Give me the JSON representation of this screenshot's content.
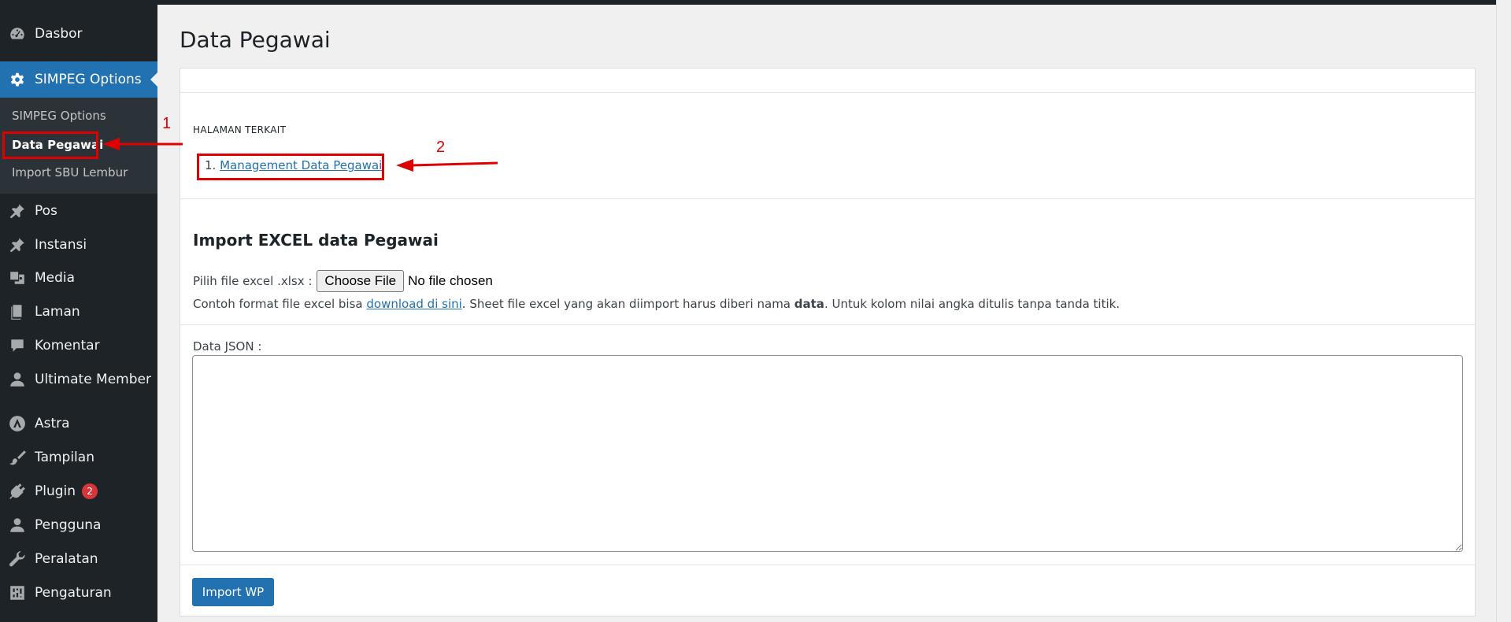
{
  "sidebar": {
    "top_items": [
      {
        "label": "Dasbor",
        "icon": "dashboard-icon"
      },
      {
        "label": "SIMPEG Options",
        "icon": "gear-icon"
      }
    ],
    "submenu": [
      {
        "label": "SIMPEG Options"
      },
      {
        "label": "Data Pegawai"
      },
      {
        "label": "Import SBU Lembur"
      }
    ],
    "items": [
      {
        "label": "Pos",
        "icon": "pin-icon"
      },
      {
        "label": "Instansi",
        "icon": "pin-icon"
      },
      {
        "label": "Media",
        "icon": "media-icon"
      },
      {
        "label": "Laman",
        "icon": "pages-icon"
      },
      {
        "label": "Komentar",
        "icon": "comment-icon"
      },
      {
        "label": "Ultimate Member",
        "icon": "user-icon"
      },
      {
        "label": "Astra",
        "icon": "astra-icon"
      },
      {
        "label": "Tampilan",
        "icon": "brush-icon"
      },
      {
        "label": "Plugin",
        "icon": "plugin-icon",
        "badge": "2"
      },
      {
        "label": "Pengguna",
        "icon": "user-icon"
      },
      {
        "label": "Peralatan",
        "icon": "wrench-icon"
      },
      {
        "label": "Pengaturan",
        "icon": "settings-icon"
      }
    ]
  },
  "main": {
    "title": "Data Pegawai",
    "related_heading": "HALAMAN TERKAIT",
    "related_number": "1.",
    "related_link": "Management Data Pegawai",
    "import_title": "Import EXCEL data Pegawai",
    "file_label": "Pilih file excel .xlsx :",
    "file_button": "Choose File",
    "file_status": "No file chosen",
    "note_prefix": "Contoh format file excel bisa ",
    "note_link": "download di sini",
    "note_mid": ". Sheet file excel yang akan diimport harus diberi nama ",
    "note_bold": "data",
    "note_suffix": ". Untuk kolom nilai angka ditulis tanpa tanda titik.",
    "json_label": "Data JSON :",
    "json_value": "",
    "import_button": "Import WP"
  },
  "annotations": {
    "num1": "1",
    "num2": "2",
    "color": "#e00000"
  },
  "colors": {
    "sidebar_bg": "#1d2327",
    "accent": "#2271b1",
    "badge": "#d63638"
  }
}
